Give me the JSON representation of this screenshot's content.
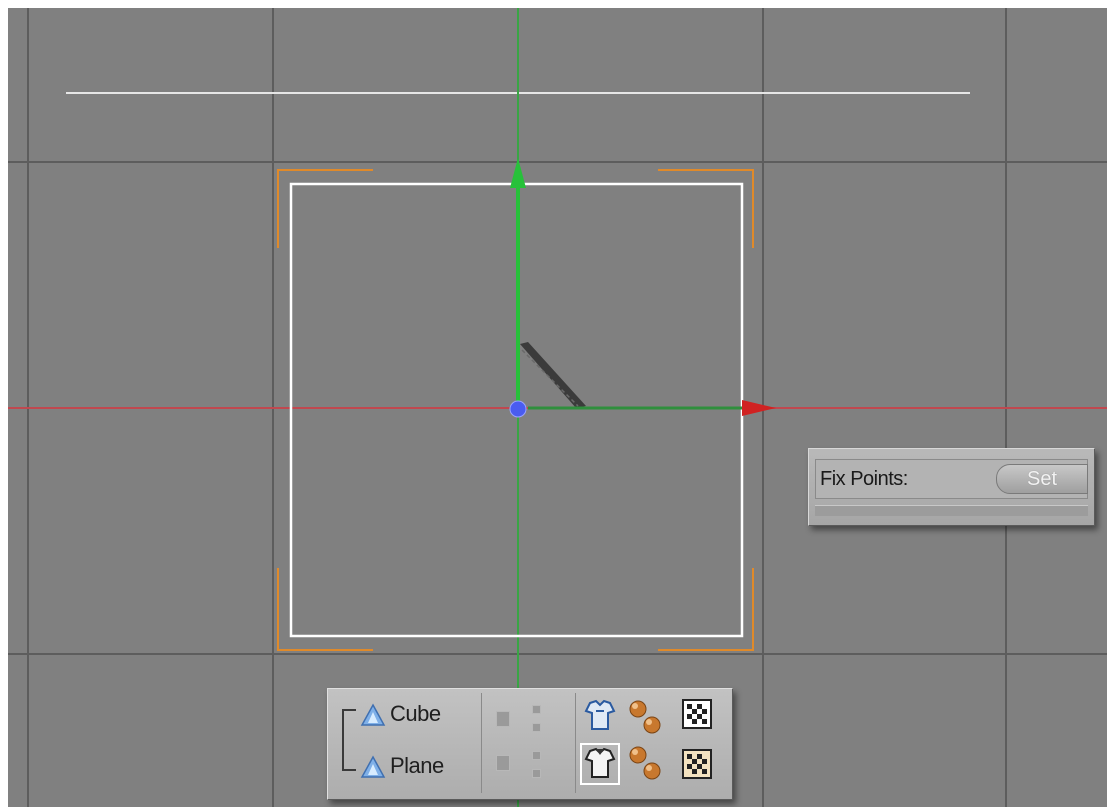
{
  "viewport": {
    "background": "#808080",
    "grid_color": "#595959",
    "x_axis_color": "#c0484f",
    "y_axis_color": "#3aa545",
    "selection_color": "#ffffff",
    "bounding_corner_color": "#e08a2a"
  },
  "fix_points": {
    "label": "Fix Points:",
    "button_label": "Set"
  },
  "layers": {
    "items": [
      {
        "name": "Cube",
        "icon": "layer-triangle-icon"
      },
      {
        "name": "Plane",
        "icon": "layer-triangle-icon"
      }
    ],
    "row_icons": [
      "shirt-icon",
      "spheres-icon",
      "checker-icon"
    ]
  }
}
